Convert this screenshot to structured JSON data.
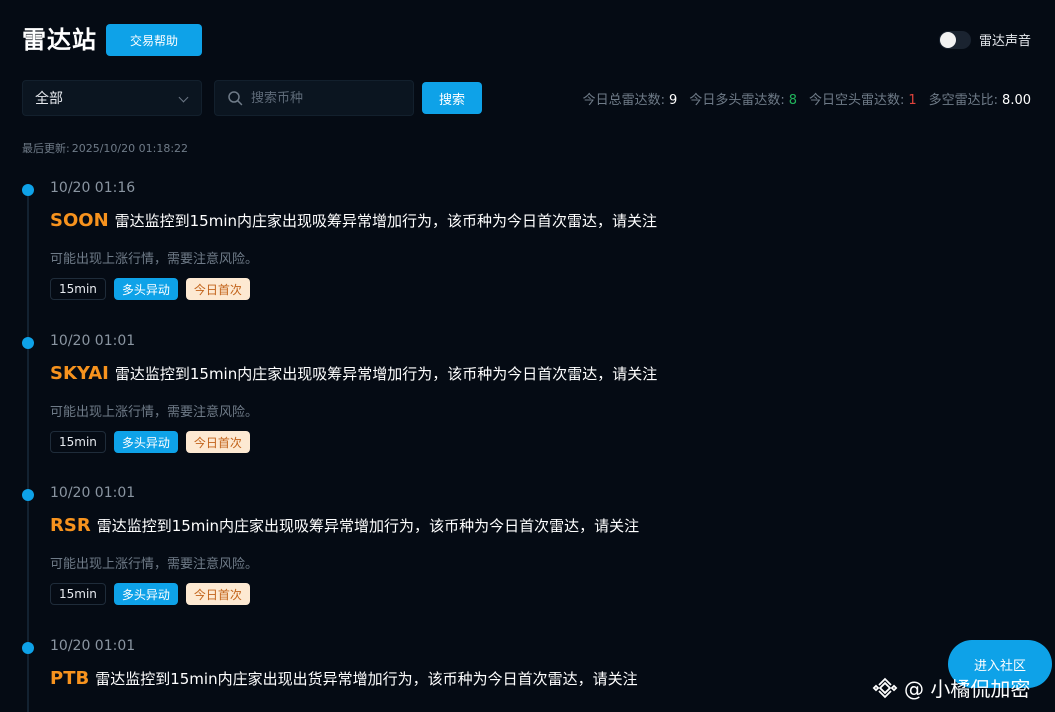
{
  "header": {
    "title": "雷达站",
    "help_button": "交易帮助",
    "sound_label": "雷达声音"
  },
  "toolbar": {
    "filter_value": "全部",
    "search_placeholder": "搜索币种",
    "search_button": "搜索"
  },
  "stats": {
    "total_label": "今日总雷达数:",
    "total_value": "9",
    "long_label": "今日多头雷达数:",
    "long_value": "8",
    "short_label": "今日空头雷达数:",
    "short_value": "1",
    "ratio_label": "多空雷达比:",
    "ratio_value": "8.00",
    "colors": {
      "long": "#21b35b",
      "short": "#e0433c"
    }
  },
  "updated": {
    "label": "最后更新:",
    "value": "2025/10/20 01:18:22"
  },
  "events": [
    {
      "time": "10/20 01:16",
      "coin": "SOON",
      "text": "雷达监控到15min内庄家出现吸筹异常增加行为，该币种为今日首次雷达，请关注",
      "desc": "可能出现上涨行情，需要注意风险。",
      "tags": [
        "15min",
        "多头异动",
        "今日首次"
      ]
    },
    {
      "time": "10/20 01:01",
      "coin": "SKYAI",
      "text": "雷达监控到15min内庄家出现吸筹异常增加行为，该币种为今日首次雷达，请关注",
      "desc": "可能出现上涨行情，需要注意风险。",
      "tags": [
        "15min",
        "多头异动",
        "今日首次"
      ]
    },
    {
      "time": "10/20 01:01",
      "coin": "RSR",
      "text": "雷达监控到15min内庄家出现吸筹异常增加行为，该币种为今日首次雷达，请关注",
      "desc": "可能出现上涨行情，需要注意风险。",
      "tags": [
        "15min",
        "多头异动",
        "今日首次"
      ]
    },
    {
      "time": "10/20 01:01",
      "coin": "PTB",
      "text": "雷达监控到15min内庄家出现出货异常增加行为，该币种为今日首次雷达，请关注"
    }
  ],
  "community_button": "进入社区",
  "watermark": "@ 小橘侃加密",
  "colors": {
    "accent": "#0ea2e8",
    "coin": "#f7931e",
    "background": "#050b14"
  }
}
